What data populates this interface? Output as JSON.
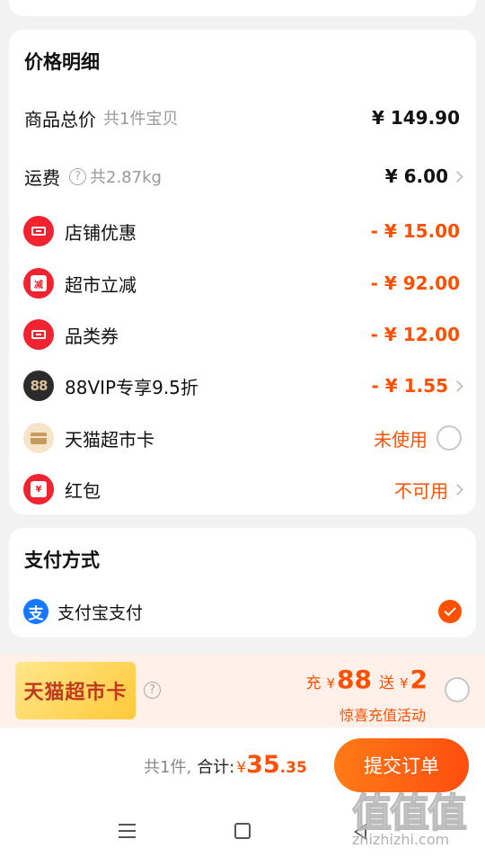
{
  "price_detail": {
    "title": "价格明细",
    "goods_total": {
      "label": "商品总价",
      "sub": "共1件宝贝",
      "value": "¥ 149.90"
    },
    "shipping": {
      "label": "运费",
      "help": "?",
      "sub": "共2.87kg",
      "value": "¥ 6.00"
    },
    "store_discount": {
      "label": "店铺优惠",
      "value": "- ¥ 15.00",
      "icon": "ticket-icon"
    },
    "market_reduce": {
      "label": "超市立减",
      "value": "- ¥ 92.00",
      "icon_text": "减"
    },
    "category_coupon": {
      "label": "品类券",
      "value": "- ¥ 12.00",
      "icon": "ticket-icon"
    },
    "vip": {
      "label": "88VIP专享9.5折",
      "value": "- ¥ 1.55",
      "icon_text": "88"
    },
    "tmall_card": {
      "label": "天猫超市卡",
      "value": "未使用",
      "icon": "card-icon"
    },
    "red_packet": {
      "label": "红包",
      "value": "不可用",
      "icon_text": "¥"
    }
  },
  "payment": {
    "title": "支付方式",
    "method": {
      "label": "支付宝支付",
      "icon_text": "支",
      "selected": true
    }
  },
  "promo": {
    "badge": "天猫超市卡",
    "help": "?",
    "charge_label": "充",
    "charge_yen": "¥",
    "charge_amount": "88",
    "gift_label": "送",
    "gift_yen": "¥",
    "gift_amount": "2",
    "subtitle": "惊喜充值活动"
  },
  "submit": {
    "count": "共1件,",
    "total_label": "合计:",
    "yen": "¥",
    "total_int": "35",
    "total_dec": ".35",
    "button": "提交订单"
  },
  "watermark": {
    "logo": "值值值",
    "url": "zhizhizhi.com"
  },
  "colors": {
    "accent": "#ff5000",
    "red": "#f0232f",
    "alipay": "#1677ff"
  }
}
